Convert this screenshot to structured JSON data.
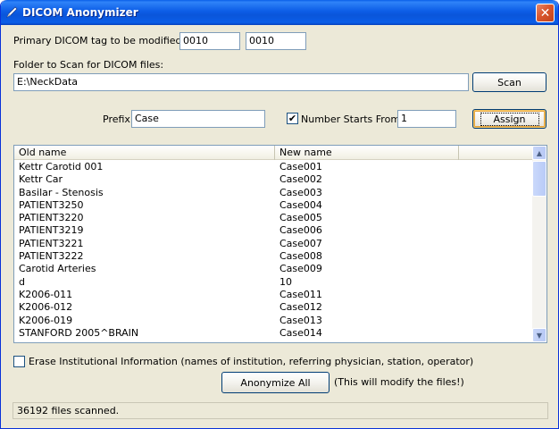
{
  "window": {
    "title": "DICOM Anonymizer",
    "close_glyph": "✕"
  },
  "tag": {
    "label": "Primary DICOM tag to be modified:",
    "group": "0010",
    "element": "0010"
  },
  "folder": {
    "label": "Folder to Scan for DICOM files:",
    "path": "E:\\NeckData",
    "scan_label": "Scan"
  },
  "naming": {
    "prefix_label": "Prefix",
    "prefix": "Case",
    "number_starts_checked": true,
    "number_starts_label": "Number Starts From",
    "start_number": "1",
    "assign_label": "Assign"
  },
  "table": {
    "headers": [
      "Old name",
      "New name"
    ],
    "rows": [
      [
        "Kettr Carotid 001",
        "Case001"
      ],
      [
        "Kettr Car",
        "Case002"
      ],
      [
        "Basilar - Stenosis",
        "Case003"
      ],
      [
        "PATIENT3250",
        "Case004"
      ],
      [
        "PATIENT3220",
        "Case005"
      ],
      [
        "PATIENT3219",
        "Case006"
      ],
      [
        "PATIENT3221",
        "Case007"
      ],
      [
        "PATIENT3222",
        "Case008"
      ],
      [
        "Carotid Arteries",
        "Case009"
      ],
      [
        "d",
        "10"
      ],
      [
        "K2006-011",
        "Case011"
      ],
      [
        "K2006-012",
        "Case012"
      ],
      [
        "K2006-019",
        "Case013"
      ],
      [
        "STANFORD 2005^BRAIN",
        "Case014"
      ]
    ]
  },
  "erase": {
    "checked": false,
    "label": "Erase Institutional Information (names of institution, referring physician, station, operator)"
  },
  "anonymize": {
    "label": "Anonymize All",
    "note": "(This will modify the files!)"
  },
  "status": {
    "text": "36192 files scanned."
  },
  "colors": {
    "titlebar": "#0a5fe8",
    "window_bg": "#ece9d8",
    "close_button": "#d9562d"
  }
}
